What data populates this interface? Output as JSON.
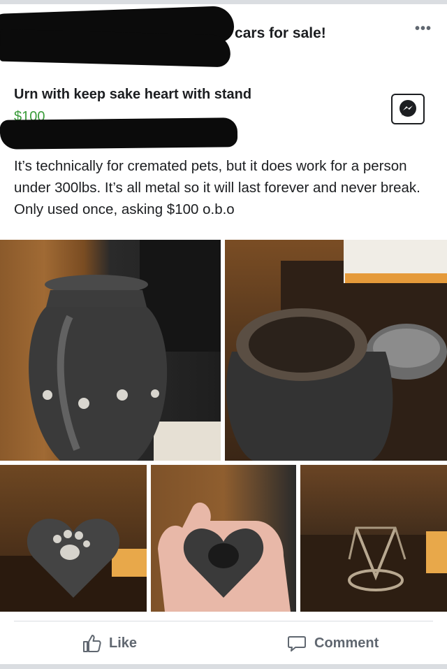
{
  "header": {
    "group_name": "laire cars for sale!",
    "more_icon": "more-dots-icon"
  },
  "listing": {
    "title": "Urn with keep sake heart with stand",
    "price": "$100",
    "description": "It’s technically for cremated pets, but it does work for a person under 300lbs. It’s all metal so it will last forever and never break. Only used once, asking $100 o.b.o",
    "messenger_icon": "messenger-icon"
  },
  "photos": [
    {
      "name": "urn-photo"
    },
    {
      "name": "urn-open-lid-photo"
    },
    {
      "name": "heart-keepsake-photo"
    },
    {
      "name": "heart-keepsake-in-hand-photo"
    },
    {
      "name": "stand-photo"
    }
  ],
  "actions": {
    "like_label": "Like",
    "comment_label": "Comment"
  },
  "colors": {
    "price": "#3a9c3a",
    "text": "#1c1e21",
    "muted": "#606770"
  }
}
